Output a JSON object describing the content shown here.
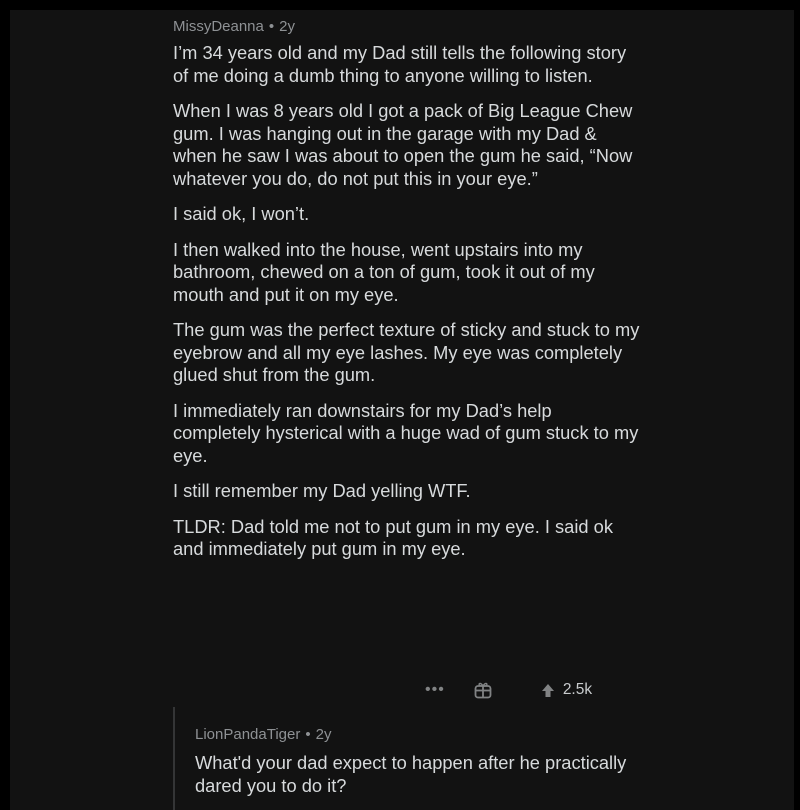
{
  "comment": {
    "author": "MissyDeanna",
    "separator": "•",
    "age": "2y",
    "paragraphs": [
      "I’m 34 years old and my Dad still tells the following story of me doing a dumb thing to anyone willing to listen.",
      "When I was 8 years old I got a pack of Big League Chew gum. I was hanging out in the garage with my Dad & when he saw I was about to open the gum he said, “Now whatever you do, do not put this in your eye.”",
      "I said ok, I won’t.",
      "I then walked into the house, went upstairs into my bathroom, chewed on a ton of gum, took it out of my mouth and put it on my eye.",
      "The gum was the perfect texture of sticky and stuck to my eyebrow and all my eye lashes. My eye was completely glued shut from the gum.",
      "I immediately ran downstairs for my Dad’s help completely hysterical with a huge wad of gum stuck to my eye.",
      "I still remember my Dad yelling WTF.",
      "TLDR: Dad told me not to put gum in my eye. I said ok and immediately put gum in my eye."
    ],
    "actions": {
      "more_label": "•••",
      "award_icon": "gift-icon",
      "upvote_icon": "upvote-arrow-icon",
      "score": "2.5k"
    }
  },
  "reply": {
    "author": "LionPandaTiger",
    "separator": "•",
    "age": "2y",
    "text": "What'd your dad expect to happen after he practically dared you to do it?"
  },
  "colors": {
    "background": "#000000",
    "panel": "#121212",
    "text": "#d7dadc",
    "meta": "#8e9194",
    "thread_line": "#343536"
  }
}
